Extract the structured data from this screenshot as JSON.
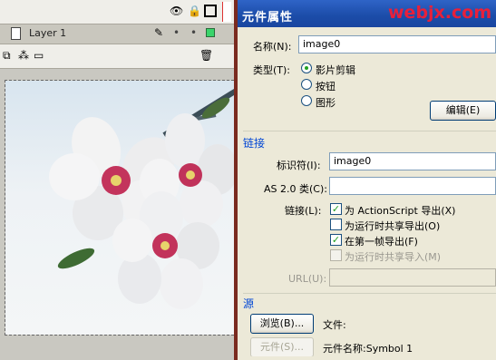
{
  "timeline": {
    "layer_name": "Layer 1"
  },
  "dialog": {
    "title": "元件属性",
    "watermark": "webjx.com",
    "name_label": "名称(N):",
    "name_value": "image0",
    "type_label": "类型(T):",
    "type_options": [
      "影片剪辑",
      "按钮",
      "图形"
    ],
    "type_selected": "影片剪辑",
    "edit_button": "编辑(E)",
    "linkage_section": "链接",
    "identifier_label": "标识符(I):",
    "identifier_value": "image0",
    "as2_class_label": "AS 2.0 类(C):",
    "as2_class_value": "",
    "linkage_label": "链接(L):",
    "linkage_options": [
      {
        "label": "为 ActionScript 导出(X)",
        "checked": true,
        "enabled": true
      },
      {
        "label": "为运行时共享导出(O)",
        "checked": false,
        "enabled": true
      },
      {
        "label": "在第一帧导出(F)",
        "checked": true,
        "enabled": true
      },
      {
        "label": "为运行时共享导入(M)",
        "checked": false,
        "enabled": false
      }
    ],
    "url_label": "URL(U):",
    "url_value": "",
    "source_section": "源",
    "browse_button": "浏览(B)...",
    "file_label": "文件:",
    "symbol_button": "元件(S)...",
    "symbol_name_label": "元件名称:Symbol 1"
  },
  "colors": {
    "title_bar": "#1b4ca8",
    "watermark": "#e8203a",
    "section_text": "#0046d5",
    "layer_status": "#3ad46b"
  },
  "icons": [
    "eye-icon",
    "lock-icon",
    "outline-square-icon",
    "page-icon",
    "pencil-icon",
    "trash-icon",
    "add-layer-icon",
    "add-motion-guide-icon",
    "insert-folder-icon"
  ]
}
